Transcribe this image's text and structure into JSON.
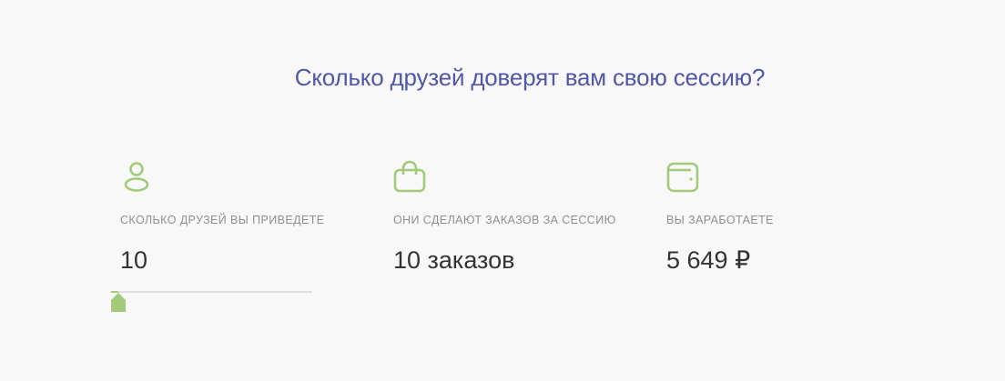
{
  "heading": "Сколько друзей доверят вам свою сессию?",
  "accent_color": "#a3ca7a",
  "heading_color": "#5157a8",
  "columns": [
    {
      "icon": "user-icon",
      "label": "СКОЛЬКО ДРУЗЕЙ ВЫ ПРИВЕДЕТЕ",
      "value": "10"
    },
    {
      "icon": "shopping-bag-icon",
      "label": "ОНИ СДЕЛАЮТ ЗАКАЗОВ ЗА СЕССИЮ",
      "value": "10 заказов"
    },
    {
      "icon": "wallet-icon",
      "label": "ВЫ ЗАРАБОТАЕТЕ",
      "value": "5 649 ₽"
    }
  ],
  "slider": {
    "value": 10,
    "fraction": 0.0
  }
}
